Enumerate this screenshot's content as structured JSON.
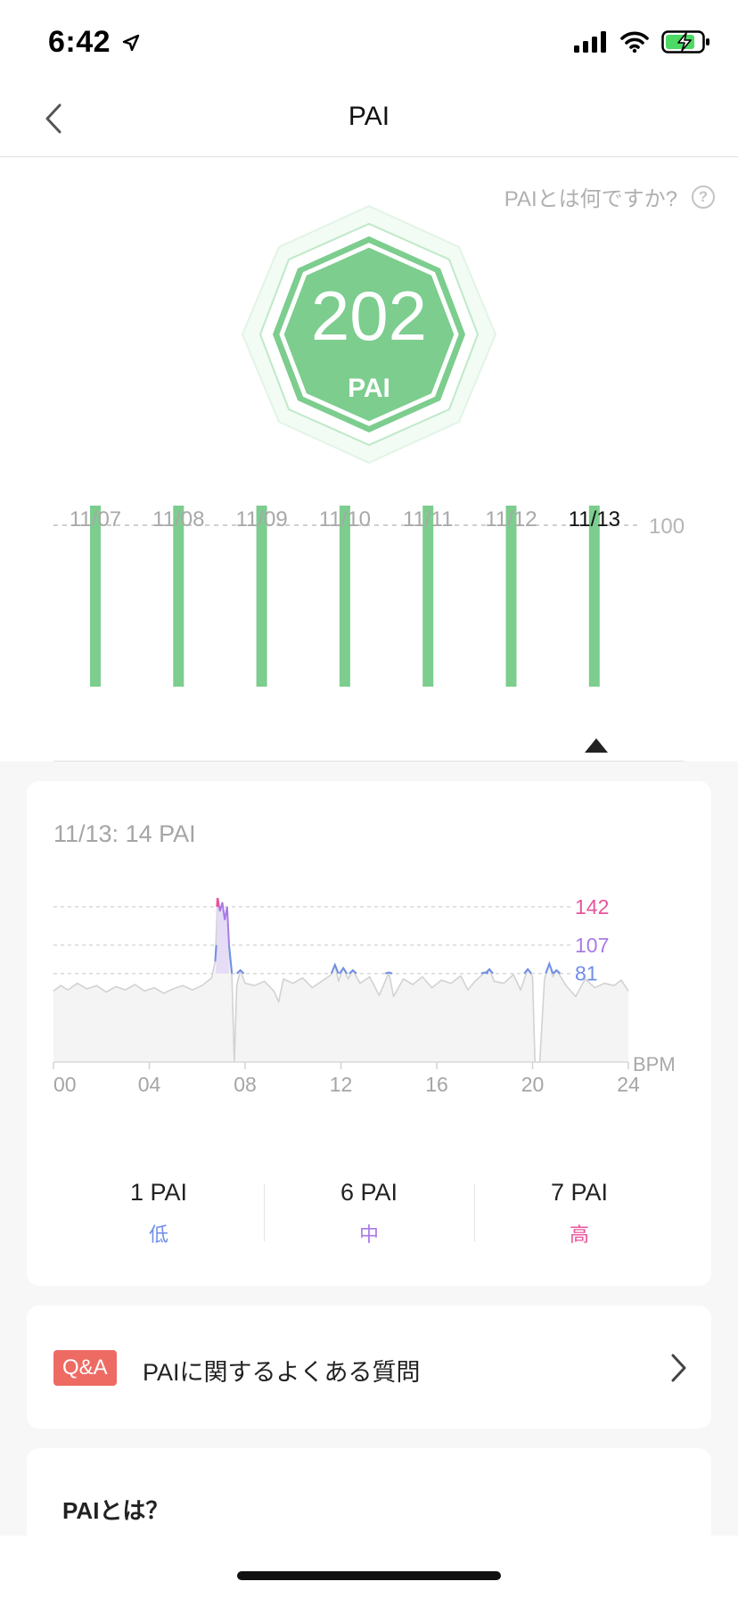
{
  "status_bar": {
    "time": "6:42"
  },
  "nav": {
    "title": "PAI"
  },
  "help": {
    "text": "PAIとは何ですか?",
    "icon": "?"
  },
  "badge": {
    "value": "202",
    "unit": "PAI"
  },
  "colors": {
    "green": "#7ccd8e",
    "low": "#6f8ee8",
    "mid": "#a97be6",
    "high": "#e8549b",
    "qa": "#ee6b63"
  },
  "weekly": {
    "reference_line": "100",
    "selected_index": 6,
    "days": [
      {
        "label": "11/07"
      },
      {
        "label": "11/08"
      },
      {
        "label": "11/09"
      },
      {
        "label": "11/10"
      },
      {
        "label": "11/11"
      },
      {
        "label": "11/12"
      },
      {
        "label": "11/13"
      }
    ]
  },
  "detail": {
    "title": "11/13: 14 PAI",
    "stats": [
      {
        "value": "1 PAI",
        "label": "低",
        "color": "#6f8ee8"
      },
      {
        "value": "6 PAI",
        "label": "中",
        "color": "#a97be6"
      },
      {
        "value": "7 PAI",
        "label": "高",
        "color": "#e8549b"
      }
    ]
  },
  "chart_data": {
    "type": "area",
    "x_tick_labels": [
      "00",
      "04",
      "08",
      "12",
      "16",
      "20",
      "24"
    ],
    "xlim": [
      0,
      24
    ],
    "ylabel": "BPM",
    "thresholds": [
      {
        "label": "142",
        "value": 142,
        "color": "#e8549b"
      },
      {
        "label": "107",
        "value": 107,
        "color": "#a97be6"
      },
      {
        "label": "81",
        "value": 81,
        "color": "#6f8ee8"
      }
    ],
    "series": [
      {
        "values": [
          [
            0,
            65
          ],
          [
            0.3,
            70
          ],
          [
            0.6,
            66
          ],
          [
            1,
            72
          ],
          [
            1.4,
            67
          ],
          [
            1.8,
            70
          ],
          [
            2.2,
            64
          ],
          [
            2.6,
            69
          ],
          [
            3,
            66
          ],
          [
            3.4,
            71
          ],
          [
            3.8,
            65
          ],
          [
            4.2,
            68
          ],
          [
            4.6,
            63
          ],
          [
            5,
            67
          ],
          [
            5.4,
            70
          ],
          [
            5.8,
            66
          ],
          [
            6.2,
            70
          ],
          [
            6.6,
            77
          ],
          [
            6.75,
            92
          ],
          [
            6.85,
            150
          ],
          [
            6.95,
            138
          ],
          [
            7.05,
            146
          ],
          [
            7.15,
            130
          ],
          [
            7.25,
            142
          ],
          [
            7.35,
            96
          ],
          [
            7.45,
            78
          ],
          [
            7.55,
            -5
          ],
          [
            7.65,
            70
          ],
          [
            7.8,
            84
          ],
          [
            8,
            72
          ],
          [
            8.4,
            70
          ],
          [
            8.8,
            74
          ],
          [
            9.2,
            65
          ],
          [
            9.4,
            55
          ],
          [
            9.6,
            76
          ],
          [
            10,
            72
          ],
          [
            10.4,
            77
          ],
          [
            10.8,
            68
          ],
          [
            11.2,
            74
          ],
          [
            11.6,
            80
          ],
          [
            11.75,
            89
          ],
          [
            11.9,
            74
          ],
          [
            12.1,
            86
          ],
          [
            12.3,
            76
          ],
          [
            12.5,
            84
          ],
          [
            12.8,
            72
          ],
          [
            13.2,
            78
          ],
          [
            13.6,
            61
          ],
          [
            14,
            82
          ],
          [
            14.2,
            60
          ],
          [
            14.6,
            76
          ],
          [
            15,
            71
          ],
          [
            15.4,
            78
          ],
          [
            15.8,
            68
          ],
          [
            16.2,
            75
          ],
          [
            16.6,
            72
          ],
          [
            17,
            79
          ],
          [
            17.3,
            66
          ],
          [
            17.6,
            74
          ],
          [
            18,
            82
          ],
          [
            18.2,
            85
          ],
          [
            18.4,
            74
          ],
          [
            18.8,
            72
          ],
          [
            19.2,
            80
          ],
          [
            19.5,
            66
          ],
          [
            19.8,
            85
          ],
          [
            20,
            78
          ],
          [
            20.1,
            -5
          ],
          [
            20.3,
            -5
          ],
          [
            20.5,
            76
          ],
          [
            20.7,
            90
          ],
          [
            20.85,
            78
          ],
          [
            21,
            84
          ],
          [
            21.4,
            70
          ],
          [
            21.8,
            60
          ],
          [
            22.2,
            76
          ],
          [
            22.6,
            68
          ],
          [
            23,
            72
          ],
          [
            23.4,
            70
          ],
          [
            23.7,
            75
          ],
          [
            24,
            65
          ]
        ]
      }
    ]
  },
  "faq": {
    "badge": "Q&A",
    "text": "PAIに関するよくある質問"
  },
  "about": {
    "title": "PAIとは？"
  }
}
